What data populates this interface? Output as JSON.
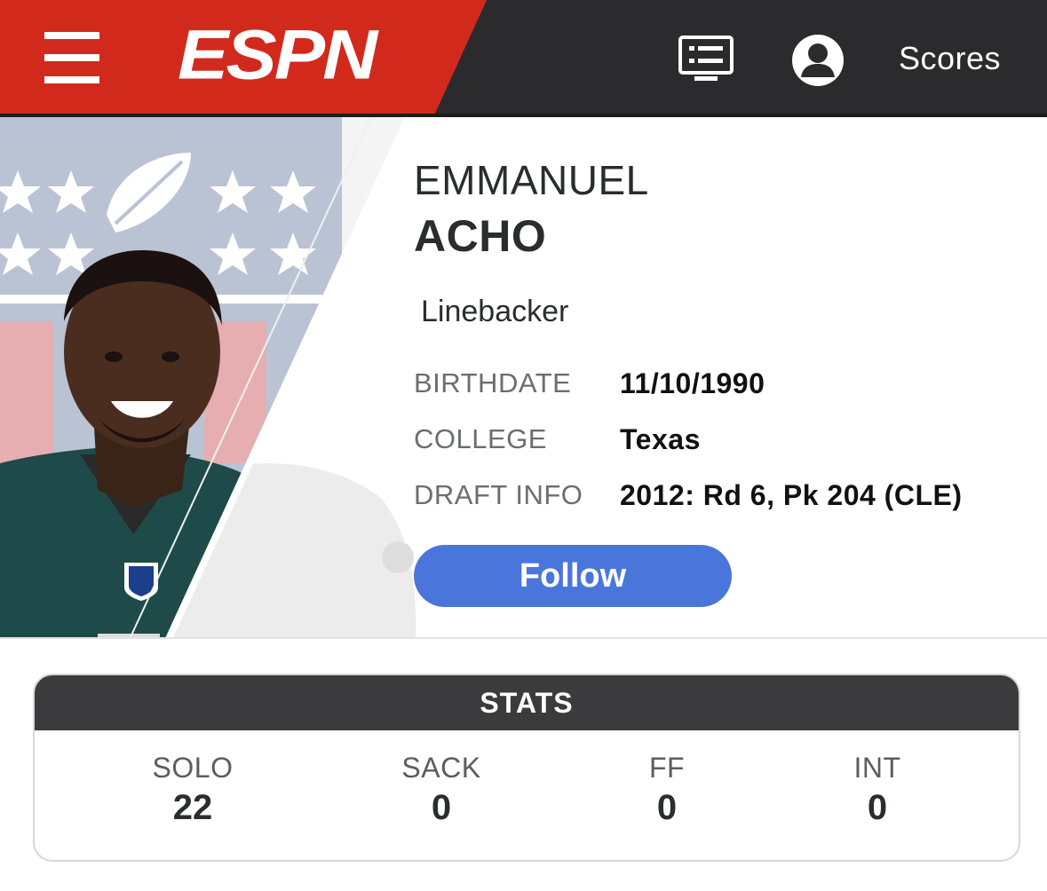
{
  "header": {
    "logo_text": "ESPN",
    "scores_label": "Scores",
    "colors": {
      "brand_red": "#d12a1c",
      "bar_dark": "#2b2b2d"
    },
    "icons": [
      "menu-icon",
      "watch-list-icon",
      "account-icon"
    ]
  },
  "player": {
    "first_name": "EMMANUEL",
    "last_name": "ACHO",
    "position": "Linebacker",
    "info": [
      {
        "label": "BIRTHDATE",
        "value": "11/10/1990"
      },
      {
        "label": "COLLEGE",
        "value": "Texas"
      },
      {
        "label": "DRAFT INFO",
        "value": "2012: Rd 6, Pk 204 (CLE)"
      }
    ],
    "follow_label": "Follow",
    "follow_color": "#4a76dc"
  },
  "stats": {
    "title": "STATS",
    "items": [
      {
        "label": "SOLO",
        "value": "22"
      },
      {
        "label": "SACK",
        "value": "0"
      },
      {
        "label": "FF",
        "value": "0"
      },
      {
        "label": "INT",
        "value": "0"
      }
    ]
  }
}
